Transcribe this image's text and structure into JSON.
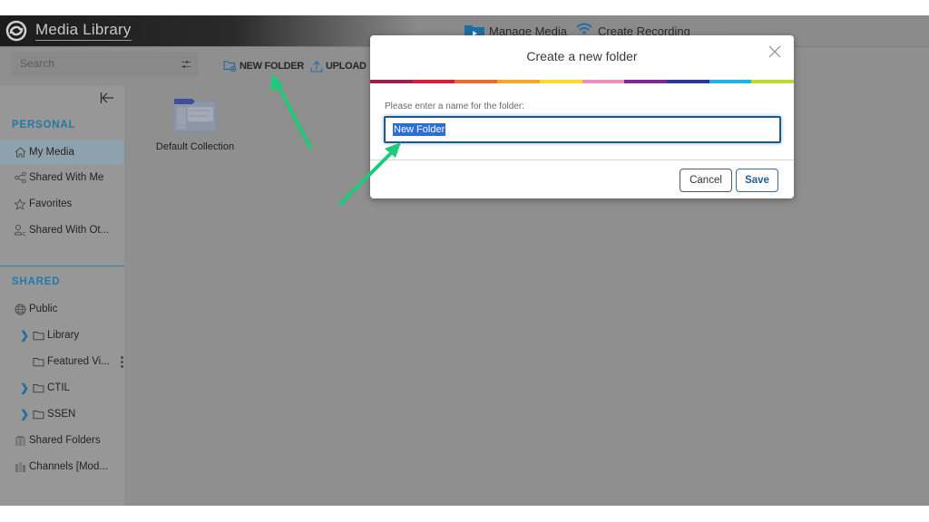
{
  "header": {
    "app_title": "Media Library",
    "nav": [
      {
        "label": "Manage Media",
        "icon": "manage-media-icon"
      },
      {
        "label": "Create Recording",
        "icon": "create-recording-icon"
      }
    ]
  },
  "toolbar": {
    "search_placeholder": "Search",
    "new_folder_label": "NEW FOLDER",
    "upload_label": "UPLOAD"
  },
  "sidebar": {
    "personal_title": "PERSONAL",
    "personal_items": [
      {
        "label": "My Media",
        "icon": "home-icon",
        "active": true
      },
      {
        "label": "Shared With Me",
        "icon": "share-icon"
      },
      {
        "label": "Favorites",
        "icon": "star-icon"
      },
      {
        "label": "Shared With Ot...",
        "icon": "user-share-icon"
      }
    ],
    "shared_title": "SHARED",
    "shared_items": [
      {
        "label": "Public",
        "icon": "globe-icon"
      },
      {
        "label": "Library",
        "icon": "folder-icon",
        "expandable": true
      },
      {
        "label": "Featured Vi...",
        "icon": "folder-icon",
        "expandable": false
      },
      {
        "label": "CTIL",
        "icon": "folder-icon",
        "expandable": true
      },
      {
        "label": "SSEN",
        "icon": "folder-icon",
        "expandable": true
      },
      {
        "label": "Shared Folders",
        "icon": "shared-folders-icon"
      },
      {
        "label": "Channels [Mod...",
        "icon": "channels-icon"
      }
    ]
  },
  "content": {
    "items": [
      {
        "label": "Default Collection"
      }
    ]
  },
  "modal": {
    "title": "Create a new folder",
    "field_label": "Please enter a name for the folder:",
    "field_value": "New Folder",
    "cancel_label": "Cancel",
    "save_label": "Save",
    "rainbow_colors": [
      "#9b2052",
      "#d6203a",
      "#ee6a2a",
      "#f7a823",
      "#f6df2a",
      "#ef8dbf",
      "#7d2a8f",
      "#2b3990",
      "#1eb6e8",
      "#c1d82f"
    ]
  },
  "colors": {
    "accent": "#1e7aa8",
    "annotation_arrow": "#1fc979"
  }
}
